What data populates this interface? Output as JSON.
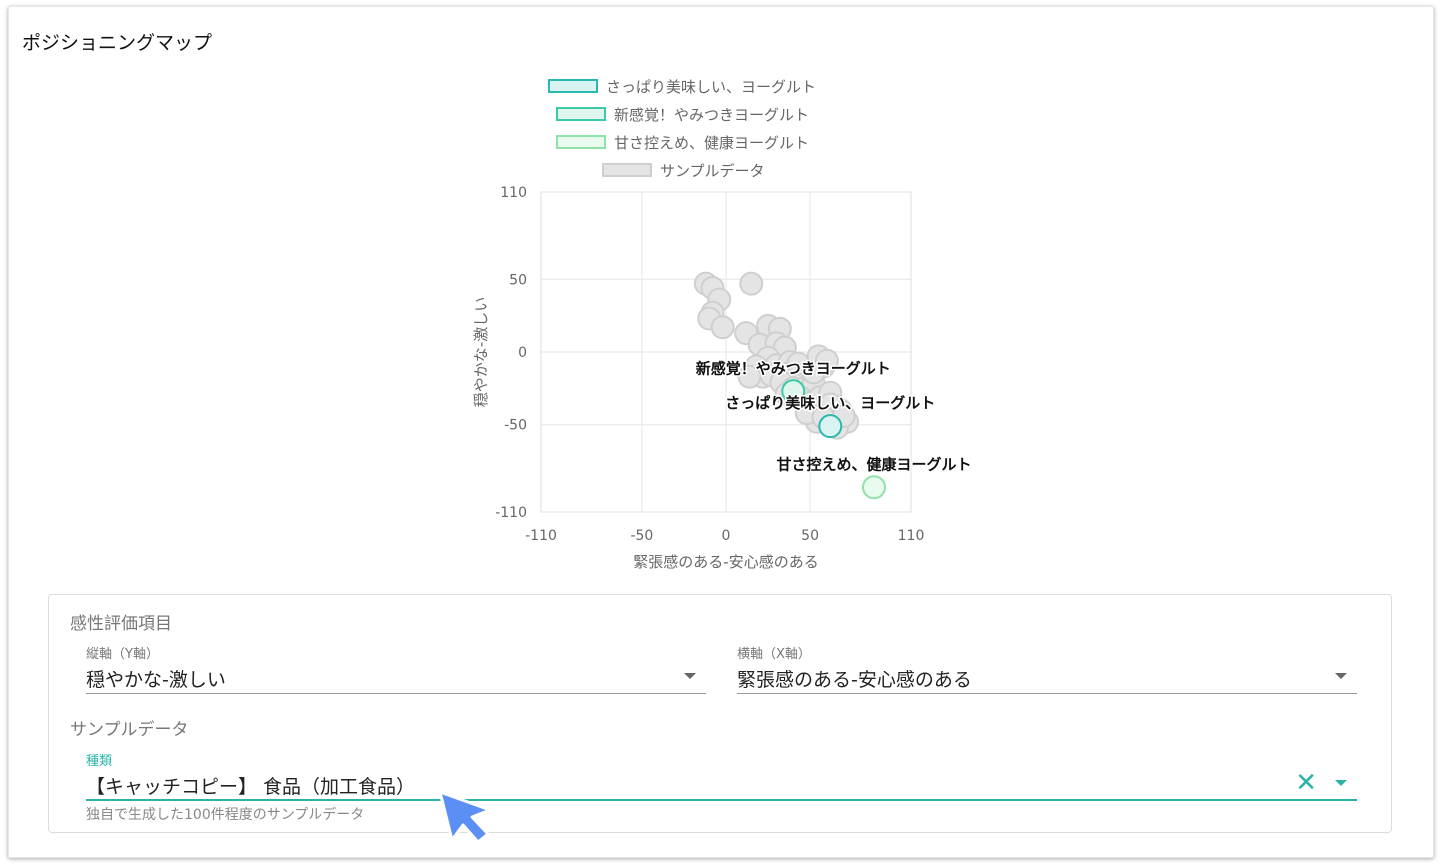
{
  "page_title": "ポジショニングマップ",
  "legend": [
    {
      "label": "さっぱり美味しい、ヨーグルト",
      "border": "#2ab7b0",
      "fill": "#d9f3f2"
    },
    {
      "label": "新感覚！やみつきヨーグルト",
      "border": "#3cc9a8",
      "fill": "#dff6ef"
    },
    {
      "label": "甘さ控えめ、健康ヨーグルト",
      "border": "#8fe2a8",
      "fill": "#e9faee"
    },
    {
      "label": "サンプルデータ",
      "border": "#cfcfcf",
      "fill": "#e4e4e4"
    }
  ],
  "chart_data": {
    "type": "scatter",
    "xlabel": "緊張感のある-安心感のある",
    "ylabel": "穏やかな-激しい",
    "xlim": [
      -110,
      110
    ],
    "ylim": [
      -110,
      110
    ],
    "xticks": [
      "-110",
      "-50",
      "0",
      "50",
      "110"
    ],
    "yticks": [
      "110",
      "50",
      "0",
      "-50",
      "-110"
    ],
    "grid": true,
    "series": [
      {
        "name": "サンプルデータ",
        "color": "#e4e4e4",
        "stroke": "#cfcfcf",
        "points": [
          [
            -12,
            47
          ],
          [
            -8,
            44
          ],
          [
            15,
            47
          ],
          [
            -4,
            36
          ],
          [
            -8,
            27
          ],
          [
            -10,
            23
          ],
          [
            -2,
            17
          ],
          [
            12,
            13
          ],
          [
            25,
            18
          ],
          [
            32,
            16
          ],
          [
            20,
            5
          ],
          [
            30,
            6
          ],
          [
            35,
            3
          ],
          [
            25,
            -4
          ],
          [
            30,
            -9
          ],
          [
            38,
            -7
          ],
          [
            18,
            -10
          ],
          [
            22,
            -17
          ],
          [
            27,
            -16
          ],
          [
            14,
            -17
          ],
          [
            40,
            -13
          ],
          [
            45,
            -11
          ],
          [
            33,
            -21
          ],
          [
            40,
            -25
          ],
          [
            48,
            -24
          ],
          [
            52,
            -21
          ],
          [
            58,
            -10
          ],
          [
            55,
            -3
          ],
          [
            60,
            -6
          ],
          [
            44,
            -31
          ],
          [
            50,
            -35
          ],
          [
            56,
            -31
          ],
          [
            62,
            -28
          ],
          [
            60,
            -40
          ],
          [
            68,
            -40
          ],
          [
            72,
            -48
          ],
          [
            66,
            -52
          ],
          [
            54,
            -48
          ],
          [
            48,
            -42
          ],
          [
            36,
            -29
          ],
          [
            62,
            -36
          ],
          [
            58,
            -45
          ],
          [
            70,
            -44
          ],
          [
            52,
            -14
          ],
          [
            43,
            -8
          ]
        ]
      },
      {
        "name": "新感覚！やみつきヨーグルト",
        "color": "#dff6ef",
        "stroke": "#3cc9a8",
        "points": [
          [
            40,
            -27
          ]
        ],
        "label": "新感覚！やみつきヨーグルト"
      },
      {
        "name": "さっぱり美味しい、ヨーグルト",
        "color": "#d9f3f2",
        "stroke": "#2ab7b0",
        "points": [
          [
            62,
            -51
          ]
        ],
        "label": "さっぱり美味しい、ヨーグルト"
      },
      {
        "name": "甘さ控えめ、健康ヨーグルト",
        "color": "#e9faee",
        "stroke": "#8fe2a8",
        "points": [
          [
            88,
            -93
          ]
        ],
        "label": "甘さ控えめ、健康ヨーグルト"
      }
    ]
  },
  "settings": {
    "section1": "感性評価項目",
    "y_axis": {
      "label": "縦軸（Y軸）",
      "value": "穏やかな-激しい"
    },
    "x_axis": {
      "label": "横軸（X軸）",
      "value": "緊張感のある-安心感のある"
    },
    "section2": "サンプルデータ",
    "kind": {
      "label": "種類",
      "value": "【キャッチコピー】 食品（加工食品）",
      "hint": "独自で生成した100件程度のサンプルデータ"
    }
  },
  "accent_color": "#2bb3a8"
}
